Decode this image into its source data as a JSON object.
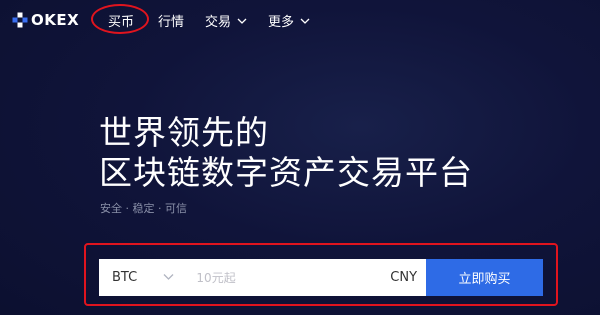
{
  "nav": {
    "logo_text": "OKEX",
    "items": [
      {
        "label": "买币"
      },
      {
        "label": "行情"
      },
      {
        "label": "交易"
      },
      {
        "label": "更多"
      }
    ]
  },
  "hero": {
    "title_line1": "世界领先的",
    "title_line2": "区块链数字资产交易平台",
    "subtitle": "安全 · 稳定 · 可信"
  },
  "buy": {
    "coin": "BTC",
    "amount_placeholder": "10元起",
    "currency": "CNY",
    "button_label": "立即购买"
  },
  "colors": {
    "background": "#10143a",
    "accent": "#2e6be6",
    "annotation": "#e0141e"
  }
}
